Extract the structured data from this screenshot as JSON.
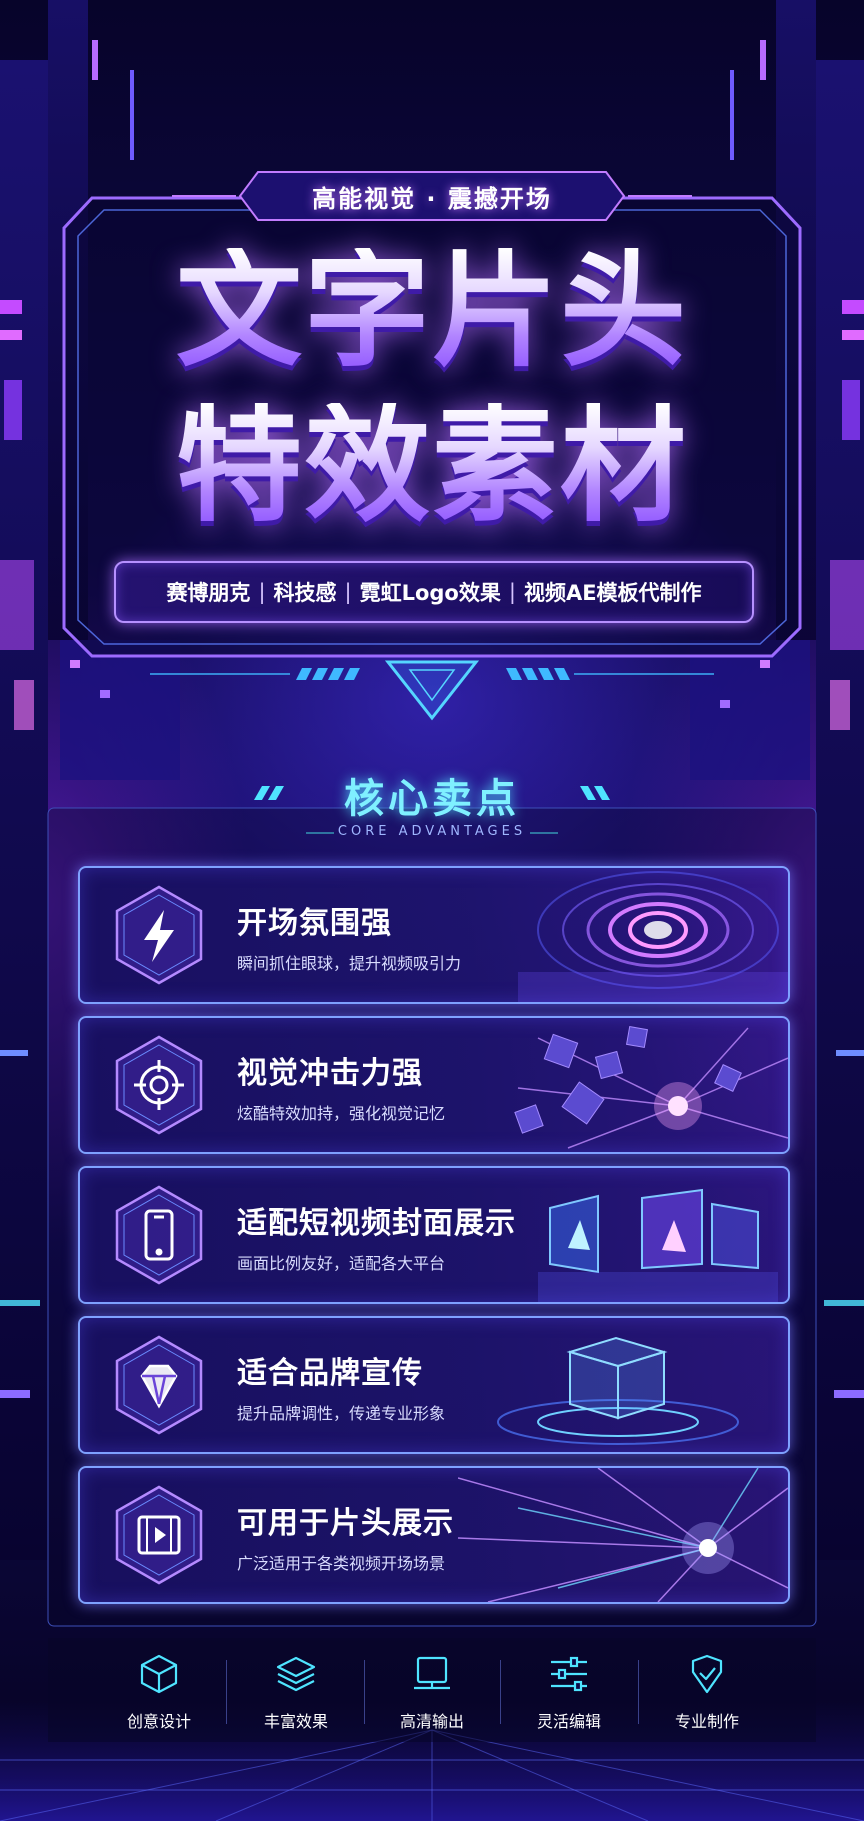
{
  "tagline": "高能视觉 · 震撼开场",
  "title": {
    "line1": "文字片头",
    "line2": "特效素材"
  },
  "subtitle_items": [
    "赛博朋克",
    "科技感",
    "霓虹Logo效果",
    "视频AE模板代制作"
  ],
  "subtitle_separator": "|",
  "section": {
    "title": "核心卖点",
    "subtitle": "CORE ADVANTAGES"
  },
  "cards": [
    {
      "icon": "lightning-icon",
      "title": "开场氛围强",
      "desc": "瞬间抓住眼球，提升视频吸引力"
    },
    {
      "icon": "target-icon",
      "title": "视觉冲击力强",
      "desc": "炫酷特效加持，强化视觉记忆"
    },
    {
      "icon": "smartphone-icon",
      "title": "适配短视频封面展示",
      "desc": "画面比例友好，适配各大平台"
    },
    {
      "icon": "diamond-icon",
      "title": "适合品牌宣传",
      "desc": "提升品牌调性，传递专业形象"
    },
    {
      "icon": "film-icon",
      "title": "可用于片头展示",
      "desc": "广泛适用于各类视频开场场景"
    }
  ],
  "features": [
    {
      "icon": "cube-icon",
      "label": "创意设计"
    },
    {
      "icon": "layers-icon",
      "label": "丰富效果"
    },
    {
      "icon": "monitor-icon",
      "label": "高清输出"
    },
    {
      "icon": "sliders-icon",
      "label": "灵活编辑"
    },
    {
      "icon": "shield-check-icon",
      "label": "专业制作"
    }
  ],
  "colors": {
    "background": "#0d0845",
    "neon_purple": "#b27cff",
    "neon_cyan": "#4fe4ff",
    "neon_blue": "#5f7dff"
  }
}
